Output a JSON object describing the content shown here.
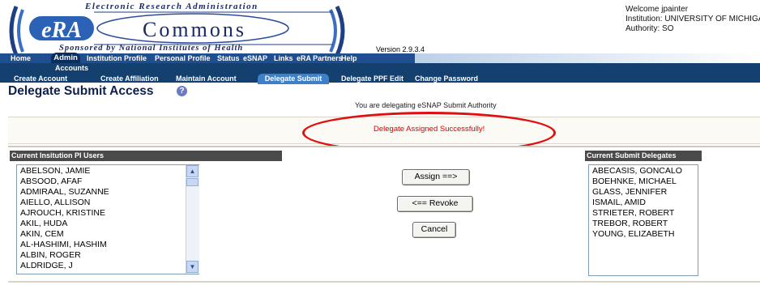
{
  "header": {
    "tagline_top": "Electronic Research Administration",
    "logo_era": "eRA",
    "logo_commons": "Commons",
    "tagline_bottom": "Sponsored by National Institutes of Health",
    "version": "Version 2.9.3.4",
    "welcome": "Welcome  jpainter",
    "institution": "Institution: UNIVERSITY OF MICHIGA",
    "authority": "Authority:  SO"
  },
  "nav_primary": {
    "items": [
      "Home",
      "Admin",
      "Institution Profile",
      "Personal Profile",
      "Status",
      "eSNAP",
      "Links",
      "eRA Partners",
      "Help"
    ],
    "active": "Admin"
  },
  "nav_secondary": {
    "section": "Accounts",
    "items": [
      "Create Account",
      "Create Affiliation",
      "Maintain Account",
      "Delegate Submit",
      "Delegate PPF Edit",
      "Change Password"
    ],
    "active": "Delegate Submit"
  },
  "page": {
    "title": "Delegate Submit Access",
    "help_icon_glyph": "?",
    "info_text": "You are delegating eSNAP Submit Authority",
    "success_message": "Delegate Assigned Successfully!"
  },
  "pi_users": {
    "header": "Current Insitution PI Users",
    "items": [
      "ABELSON, JAMIE",
      "ABSOOD, AFAF",
      "ADMIRAAL, SUZANNE",
      "AIELLO, ALLISON",
      "AJROUCH, KRISTINE",
      "AKIL, HUDA",
      "AKIN, CEM",
      "AL-HASHIMI, HASHIM",
      "ALBIN, ROGER",
      "ALDRIDGE, J"
    ]
  },
  "buttons": {
    "assign": "Assign ==>",
    "revoke": "<== Revoke",
    "cancel": "Cancel"
  },
  "delegates": {
    "header": "Current Submit Delegates",
    "items": [
      "ABECASIS, GONCALO",
      "BOEHNKE, MICHAEL",
      "GLASS, JENNIFER",
      "ISMAIL, AMID",
      "STRIETER, ROBERT",
      "TREBOR, ROBERT",
      "YOUNG, ELIZABETH"
    ]
  },
  "colors": {
    "nav_dark": "#1f4f91",
    "nav_secondary": "#14406f",
    "active_tab": "#3f7fc8",
    "success_red": "#d60000",
    "annotation_red": "#e01010"
  },
  "icons": {
    "help": "question-circle-icon",
    "scroll_up": "scroll-up-arrow-icon",
    "scroll_down": "scroll-down-arrow-icon"
  }
}
